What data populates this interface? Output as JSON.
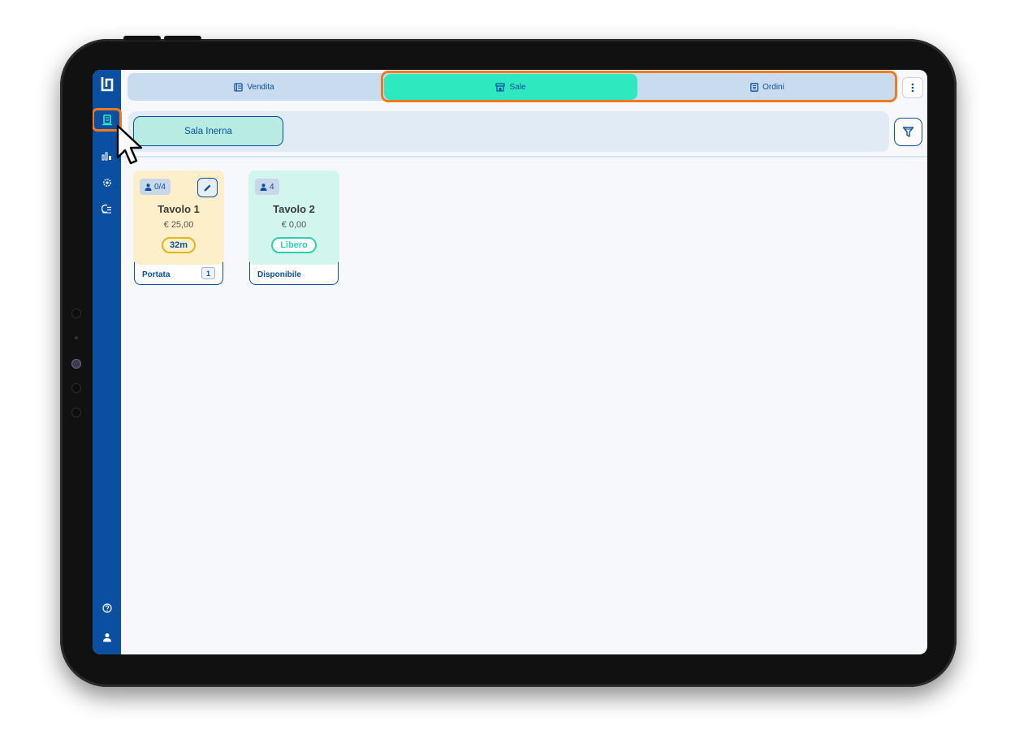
{
  "nav": {
    "items": [
      "orders",
      "statistics",
      "settings",
      "cash-register"
    ],
    "bottom": [
      "help",
      "user"
    ]
  },
  "tabs": {
    "vendita": "Vendita",
    "sale": "Sale",
    "ordini": "Ordini",
    "active": "Sale"
  },
  "room": {
    "selected": "Sala Inerna"
  },
  "tables": [
    {
      "name": "Tavolo 1",
      "guests": "0/4",
      "price": "€ 25,00",
      "status": "32m",
      "footer_label": "Portata",
      "footer_count": "1"
    },
    {
      "name": "Tavolo 2",
      "guests": "4",
      "price": "€ 0,00",
      "status": "Libero",
      "footer_label": "Disponibile"
    }
  ],
  "colors": {
    "primary": "#0b4fa3",
    "active_tab": "#2ee8c0",
    "highlight": "#f27a1a",
    "occupied_card": "#fdefc9",
    "free_card": "#d2f5ee"
  }
}
